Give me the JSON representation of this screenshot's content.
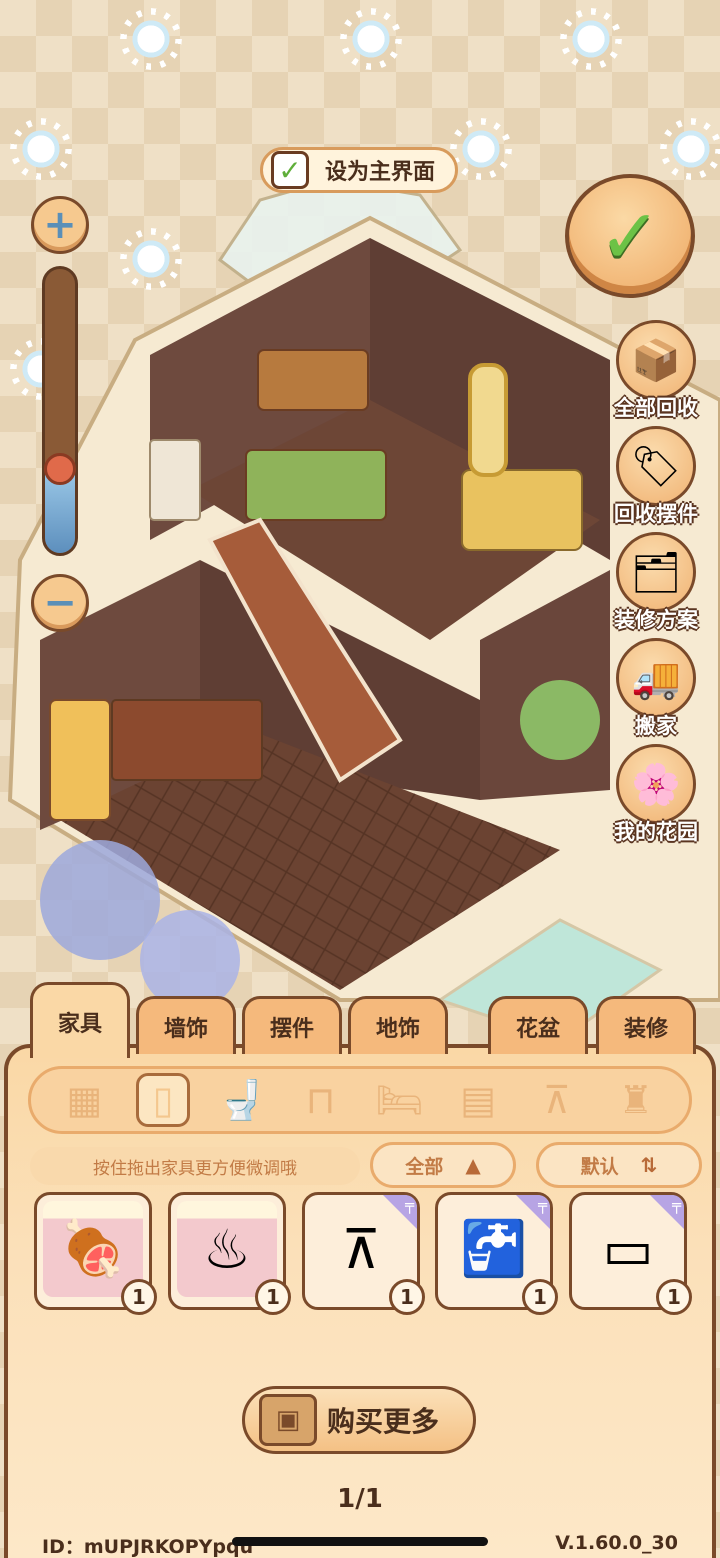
{
  "toolbar": {
    "set_main_label": "设为主界面",
    "set_main_icon": "check-icon"
  },
  "zoom": {
    "plus_icon": "plus-icon",
    "minus_icon": "minus-icon",
    "level": 0.3
  },
  "side_actions": [
    {
      "label": "全部回收",
      "icon": "recycle-all-icon"
    },
    {
      "label": "回收摆件",
      "icon": "recycle-ornament-icon"
    },
    {
      "label": "装修方案",
      "icon": "decor-plan-icon"
    },
    {
      "label": "搬家",
      "icon": "moving-truck-icon"
    },
    {
      "label": "我的花园",
      "icon": "garden-arch-icon"
    }
  ],
  "tabs": [
    {
      "label": "家具",
      "active": true
    },
    {
      "label": "墙饰",
      "active": false
    },
    {
      "label": "摆件",
      "active": false
    },
    {
      "label": "地饰",
      "active": false
    },
    {
      "label": "花盆",
      "active": false
    },
    {
      "label": "装修",
      "active": false
    }
  ],
  "categories": [
    {
      "icon": "grid-all-icon",
      "active": false
    },
    {
      "icon": "fridge-icon",
      "active": true
    },
    {
      "icon": "toilet-icon",
      "active": false
    },
    {
      "icon": "stool-icon",
      "active": false
    },
    {
      "icon": "bed-icon",
      "active": false
    },
    {
      "icon": "cabinet-icon",
      "active": false
    },
    {
      "icon": "table-icon",
      "active": false
    },
    {
      "icon": "lamp-icon",
      "active": false
    }
  ],
  "hint": "按住拖出家具更方便微调哦",
  "filter": {
    "label": "全部",
    "icon": "triangle-up-icon"
  },
  "sort": {
    "label": "默认",
    "icon": "sort-icon"
  },
  "items": [
    {
      "name": "grill",
      "count": "1",
      "icon": "grill-icon",
      "new": false
    },
    {
      "name": "stove",
      "count": "1",
      "icon": "stove-icon",
      "new": false
    },
    {
      "name": "table",
      "count": "1",
      "icon": "table-icon",
      "new": true
    },
    {
      "name": "sink-counter",
      "count": "1",
      "icon": "sink-icon",
      "new": true
    },
    {
      "name": "counter",
      "count": "1",
      "icon": "counter-icon",
      "new": true
    }
  ],
  "buy_more": "购买更多",
  "page": "1/1",
  "user_id": "ID：mUPJRKOPYpqu",
  "version": "V.1.60.0_30",
  "colors": {
    "panel": "#fad8a6",
    "outline": "#7a4a2a",
    "accent_green": "#6cc246",
    "badge_purple": "#b7a4e4"
  }
}
